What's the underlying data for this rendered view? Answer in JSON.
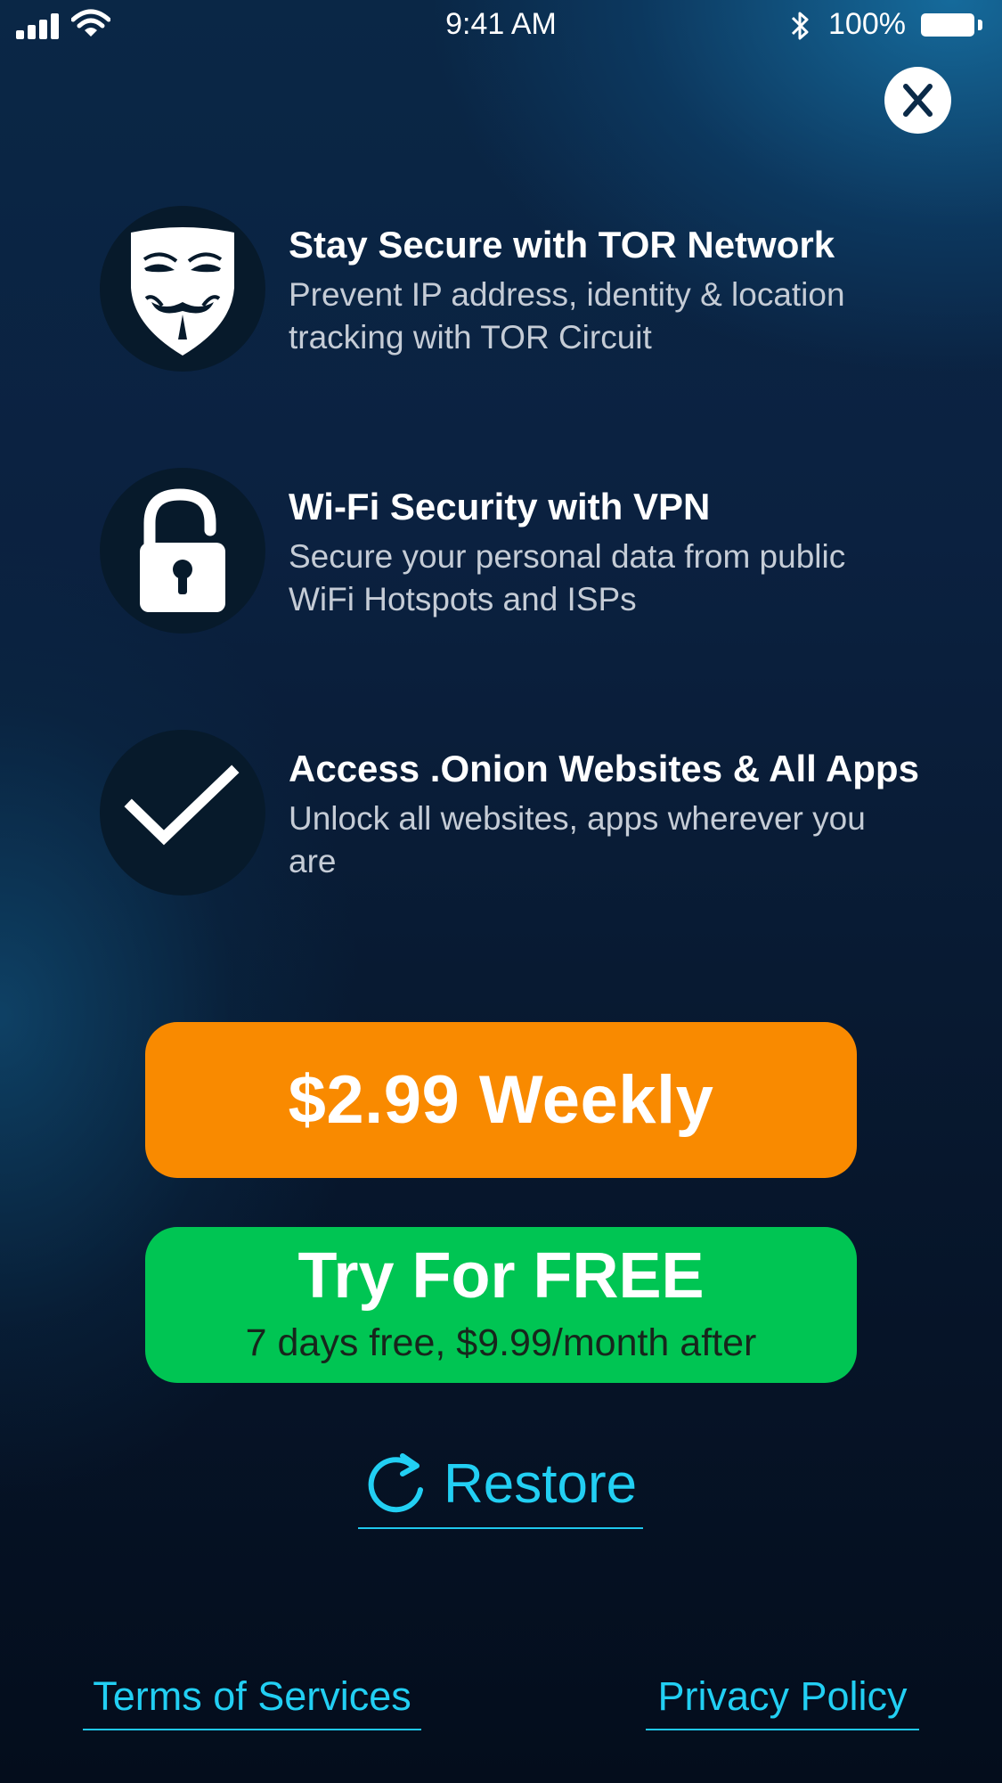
{
  "status_bar": {
    "time": "9:41 AM",
    "battery_percent": "100%",
    "icons": [
      "signal-bars-icon",
      "wifi-icon",
      "bluetooth-icon",
      "battery-icon"
    ]
  },
  "close": {
    "icon": "close-icon"
  },
  "features": [
    {
      "icon": "mask-icon",
      "title": "Stay Secure with TOR Network",
      "description": "Prevent IP address, identity & location tracking with TOR Circuit"
    },
    {
      "icon": "lock-icon",
      "title": "Wi-Fi Security with VPN",
      "description": "Secure your personal data from public WiFi Hotspots and ISPs"
    },
    {
      "icon": "checkmark-icon",
      "title": "Access .Onion Websites & All Apps",
      "description": "Unlock all websites, apps wherever you are"
    }
  ],
  "plans": {
    "weekly_label": "$2.99 Weekly",
    "trial_title": "Try For FREE",
    "trial_subtitle": "7 days free, $9.99/month after"
  },
  "restore": {
    "icon": "refresh-icon",
    "label": "Restore"
  },
  "footer": {
    "terms_label": "Terms of Services",
    "privacy_label": "Privacy Policy"
  },
  "colors": {
    "weekly_button": "#f98a00",
    "trial_button": "#00c553",
    "link": "#22cff3",
    "icon_circle": "#071a2b"
  }
}
